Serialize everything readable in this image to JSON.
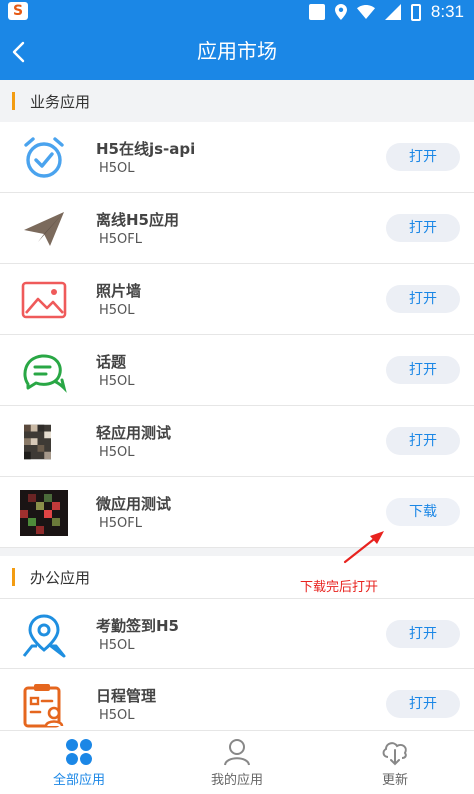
{
  "status_bar": {
    "time": "8:31",
    "notification_icon": "sogou-input-icon"
  },
  "header": {
    "title": "应用市场",
    "back_icon": "back-arrow-icon"
  },
  "sections": [
    {
      "label": "业务应用",
      "apps": [
        {
          "name": "H5在线js-api",
          "sub": "H5OL",
          "action": "打开",
          "icon": "alarm-clock-icon"
        },
        {
          "name": "离线H5应用",
          "sub": "H5OFL",
          "action": "打开",
          "icon": "paper-plane-icon"
        },
        {
          "name": "照片墙",
          "sub": "H5OL",
          "action": "打开",
          "icon": "picture-icon"
        },
        {
          "name": "话题",
          "sub": "H5OL",
          "action": "打开",
          "icon": "chat-bubbles-icon"
        },
        {
          "name": "轻应用测试",
          "sub": "H5OL",
          "action": "打开",
          "icon": "pixelated-image-icon"
        },
        {
          "name": "微应用测试",
          "sub": "H5OFL",
          "action": "下载",
          "icon": "pixelated-image-icon"
        }
      ]
    },
    {
      "label": "办公应用",
      "apps": [
        {
          "name": "考勤签到H5",
          "sub": "H5OL",
          "action": "打开",
          "icon": "location-pin-icon"
        },
        {
          "name": "日程管理",
          "sub": "H5OL",
          "action": "打开",
          "icon": "clipboard-person-icon"
        }
      ]
    }
  ],
  "annotation": {
    "text": "下载完后打开",
    "color": "#e8231f"
  },
  "tabs": [
    {
      "label": "全部应用",
      "icon": "grid-icon",
      "active": true
    },
    {
      "label": "我的应用",
      "icon": "user-icon",
      "active": false
    },
    {
      "label": "更新",
      "icon": "cloud-download-icon",
      "active": false
    }
  ],
  "colors": {
    "primary": "#1b87e6",
    "accent_bar": "#f39c12"
  }
}
